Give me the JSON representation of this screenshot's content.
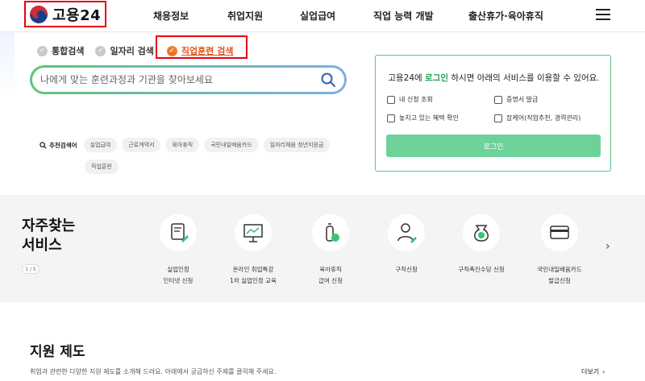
{
  "header": {
    "logo_text": "고용24",
    "nav": [
      "채용정보",
      "취업지원",
      "실업급여",
      "직업 능력 개발",
      "출산휴가·육아휴직"
    ]
  },
  "search": {
    "tabs": [
      {
        "label": "통합검색",
        "active": false
      },
      {
        "label": "일자리 검색",
        "active": false
      },
      {
        "label": "직업훈련 검색",
        "active": true
      }
    ],
    "placeholder": "나에게 맞는 훈련과정과 기관을 찾아보세요",
    "recommended_label": "추천검색어",
    "chips": [
      "실업급여",
      "근로계약서",
      "육아휴직",
      "국민내일배움카드",
      "일자리채움 청년지원금",
      "직업훈련"
    ]
  },
  "login_box": {
    "message_prefix": "고용24에",
    "message_link": "로그인",
    "message_suffix": "하시면 아래의 서비스를 이용할 수 있어요.",
    "services": [
      "내 신청 조회",
      "증명서 발급",
      "놓치고 있는 혜택 확인",
      "잡케어(직업추천, 경력관리)"
    ],
    "button_label": "로그인"
  },
  "frequent": {
    "title_line1": "자주찾는",
    "title_line2": "서비스",
    "pager": "1 / 5",
    "items": [
      {
        "label": "실업인정\n인터넷 신청",
        "icon": "document-pen-icon"
      },
      {
        "label": "온라인 취업특강\n1차 실업인정 교육",
        "icon": "presentation-board-icon"
      },
      {
        "label": "육아휴직\n급여 신청",
        "icon": "baby-bottle-icon"
      },
      {
        "label": "구직신청",
        "icon": "person-pen-icon"
      },
      {
        "label": "구직촉진수당 신청",
        "icon": "money-bag-icon"
      },
      {
        "label": "국민내일배움카드\n발급신청",
        "icon": "credit-card-icon"
      }
    ]
  },
  "support": {
    "title": "지원 제도",
    "description": "취업과 관련한 다양한 지원 제도를 소개해 드려요. 아래에서 궁금하신 주제를 클릭해 주세요.",
    "more_label": "더보기"
  },
  "colors": {
    "highlight_border": "#e60012",
    "accent_green": "#1f9d55",
    "active_tab": "#e2541b"
  }
}
